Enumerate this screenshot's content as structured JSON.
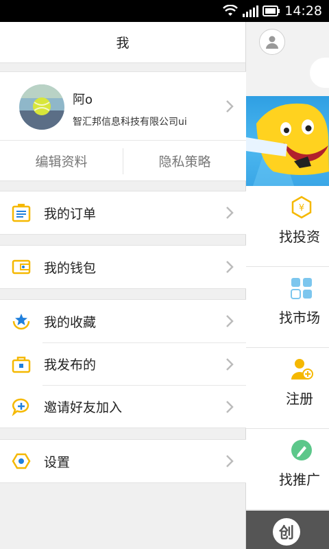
{
  "status_bar": {
    "time": "14:28"
  },
  "drawer": {
    "title": "我",
    "profile": {
      "name": "阿o",
      "company": "智汇邦信息科技有限公司ui",
      "edit_label": "编辑资料",
      "privacy_label": "隐私策略"
    },
    "menu_groups": [
      [
        {
          "label": "我的订单",
          "icon": "order-icon"
        }
      ],
      [
        {
          "label": "我的钱包",
          "icon": "wallet-icon"
        }
      ],
      [
        {
          "label": "我的收藏",
          "icon": "favorites-icon"
        },
        {
          "label": "我发布的",
          "icon": "briefcase-icon"
        },
        {
          "label": "邀请好友加入",
          "icon": "invite-icon"
        }
      ],
      [
        {
          "label": "设置",
          "icon": "settings-icon"
        }
      ]
    ]
  },
  "main": {
    "features": [
      {
        "label": "找投资",
        "icon": "invest-icon"
      },
      {
        "label": "找市场",
        "icon": "market-icon"
      },
      {
        "label": "注册",
        "icon": "register-icon"
      },
      {
        "label": "找推广",
        "icon": "promote-icon"
      }
    ],
    "bottom_logo": "创"
  },
  "colors": {
    "accent_yellow": "#f5b800",
    "accent_blue": "#1f7fdc",
    "divider": "#e2e2e2"
  }
}
